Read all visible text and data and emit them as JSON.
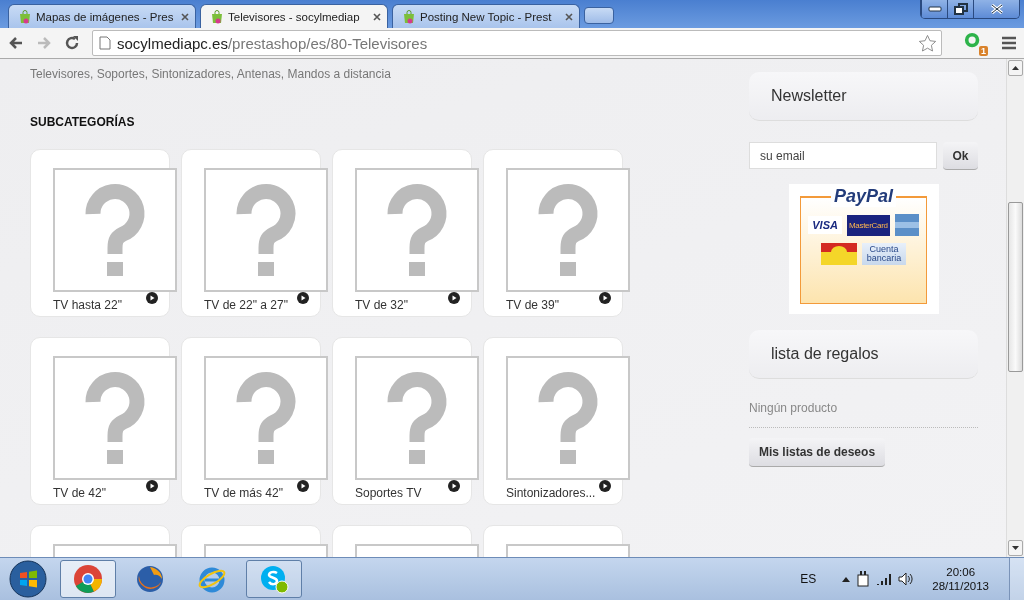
{
  "tabs": [
    {
      "title": "Mapas de imágenes - Pres",
      "selected": false
    },
    {
      "title": "Televisores - socylmediap",
      "selected": true
    },
    {
      "title": "Posting New Topic - Prest",
      "selected": false
    }
  ],
  "address_bar": {
    "host": "socylmediapc.es",
    "path": "/prestashop/es/80-Televisores"
  },
  "extension_badge": "1",
  "page": {
    "description": "Televisores, Soportes, Sintonizadores, Antenas, Mandos a distancia",
    "subcategories_heading": "SUBCATEGORÍAS",
    "subcategories": [
      {
        "kind": "full",
        "label": "TV hasta 22\""
      },
      {
        "kind": "full",
        "label": "TV de 22\" a 27\""
      },
      {
        "kind": "full",
        "label": "TV de 32\""
      },
      {
        "kind": "full",
        "label": "TV de 39\""
      },
      {
        "kind": "full",
        "label": "TV de 42\""
      },
      {
        "kind": "full",
        "label": "TV de más 42\""
      },
      {
        "kind": "full",
        "label": "Soportes TV"
      },
      {
        "kind": "full",
        "label": "Sintonizadores..."
      },
      {
        "kind": "partial"
      },
      {
        "kind": "partial"
      },
      {
        "kind": "partial"
      },
      {
        "kind": "partial"
      }
    ]
  },
  "sidebar": {
    "newsletter_title": "Newsletter",
    "email_placeholder": "su email",
    "ok_button": "Ok",
    "paypal": {
      "brand": "PayPal",
      "visa": "VISA",
      "mastercard": "MasterCard",
      "bank": "Cuenta bancaria"
    },
    "wishlist_title": "lista de regalos",
    "wishlist_empty": "Ningún producto",
    "wishlist_button": "Mis listas de deseos"
  },
  "taskbar": {
    "apps": [
      {
        "kind": "chrome",
        "selected": true,
        "running": true
      },
      {
        "kind": "firefox",
        "selected": false,
        "running": false
      },
      {
        "kind": "ie",
        "selected": false,
        "running": false
      },
      {
        "kind": "skype",
        "selected": false,
        "running": true
      }
    ],
    "language": "ES",
    "time": "20:06",
    "date": "28/11/2013"
  }
}
